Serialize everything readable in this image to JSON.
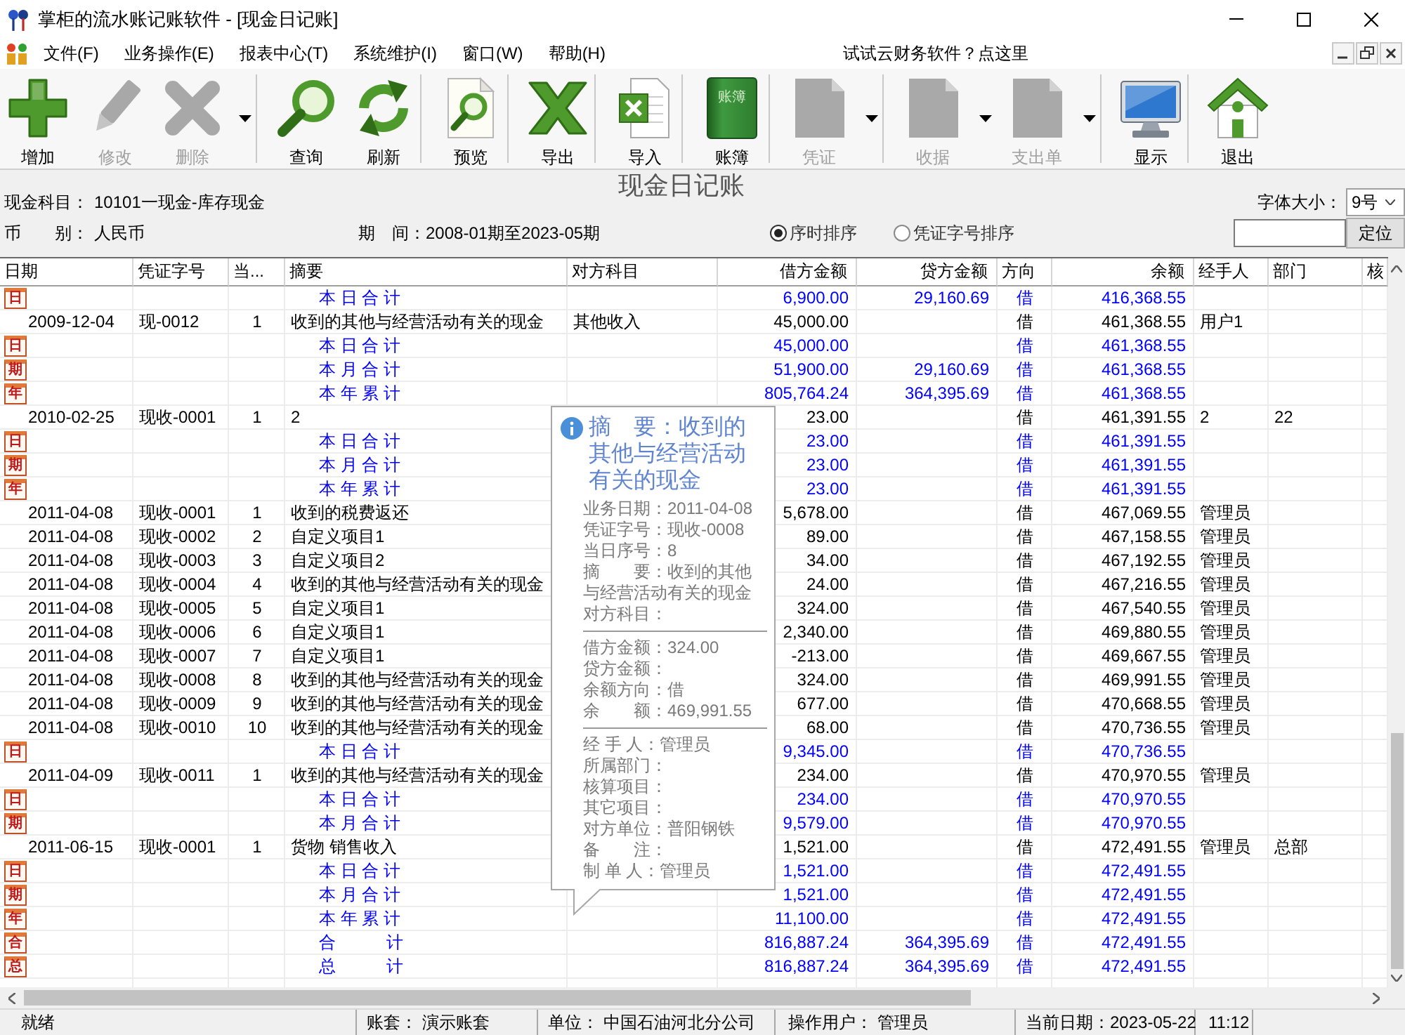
{
  "window": {
    "title": "掌柜的流水账记账软件 - [现金日记账]"
  },
  "menu": {
    "items": [
      "文件(F)",
      "业务操作(E)",
      "报表中心(T)",
      "系统维护(I)",
      "窗口(W)",
      "帮助(H)"
    ],
    "promo_link": "试试云财务软件？点这里"
  },
  "toolbar_groups": [
    {
      "buttons": [
        {
          "label": "增加",
          "disabled": false,
          "dropdown": false
        },
        {
          "label": "修改",
          "disabled": true,
          "dropdown": false
        },
        {
          "label": "删除",
          "disabled": true,
          "dropdown": true
        }
      ]
    },
    {
      "buttons": [
        {
          "label": "查询",
          "disabled": false,
          "dropdown": false
        },
        {
          "label": "刷新",
          "disabled": false,
          "dropdown": false
        }
      ]
    },
    {
      "buttons": [
        {
          "label": "预览",
          "disabled": false,
          "dropdown": false
        }
      ]
    },
    {
      "buttons": [
        {
          "label": "导出",
          "disabled": false,
          "dropdown": false
        }
      ]
    },
    {
      "buttons": [
        {
          "label": "导入",
          "disabled": false,
          "dropdown": false
        }
      ]
    },
    {
      "buttons": [
        {
          "label": "账簿",
          "cover_text": "账簿",
          "disabled": false,
          "dropdown": false
        }
      ]
    },
    {
      "buttons": [
        {
          "label": "凭证",
          "disabled": true,
          "dropdown": true
        }
      ]
    },
    {
      "buttons": [
        {
          "label": "收据",
          "disabled": true,
          "dropdown": true
        },
        {
          "label": "支出单",
          "disabled": true,
          "dropdown": true
        }
      ]
    },
    {
      "buttons": [
        {
          "label": "显示",
          "disabled": false,
          "dropdown": false
        }
      ]
    },
    {
      "buttons": [
        {
          "label": "退出",
          "disabled": false,
          "dropdown": false
        }
      ]
    }
  ],
  "header": {
    "title": "现金日记账",
    "account_label": "现金科目：",
    "account": "10101一现金-库存现金",
    "currency_label": "币　　别：",
    "currency": "人民币",
    "period_label": "期　间：",
    "period": "2008-01期至2023-05期",
    "font_size_label": "字体大小：",
    "font_size": "9号",
    "sort_options": [
      {
        "label": "序时排序",
        "selected": true
      },
      {
        "label": "凭证字号排序",
        "selected": false
      }
    ],
    "locate_button": "定位"
  },
  "table": {
    "columns": [
      "日期",
      "凭证字号",
      "当...",
      "摘要",
      "对方科目",
      "借方金额",
      "贷方金额",
      "方向",
      "余额",
      "经手人",
      "部门",
      "核"
    ],
    "rows": [
      {
        "kind": "subtotal",
        "tag": "日",
        "summary": "本 日 合 计",
        "debit": "6,900.00",
        "credit": "29,160.69",
        "direction": "借",
        "balance": "416,368.55"
      },
      {
        "kind": "entry",
        "date": "2009-12-04",
        "voucher": "现-0012",
        "seq": "1",
        "summary": "收到的其他与经营活动有关的现金",
        "counter_account": "其他收入",
        "debit": "45,000.00",
        "direction": "借",
        "balance": "461,368.55",
        "handler": "用户1"
      },
      {
        "kind": "subtotal",
        "tag": "日",
        "summary": "本 日 合 计",
        "debit": "45,000.00",
        "direction": "借",
        "balance": "461,368.55"
      },
      {
        "kind": "subtotal",
        "tag": "期",
        "summary": "本 月 合 计",
        "debit": "51,900.00",
        "credit": "29,160.69",
        "direction": "借",
        "balance": "461,368.55"
      },
      {
        "kind": "subtotal",
        "tag": "年",
        "summary": "本 年 累 计",
        "debit": "805,764.24",
        "credit": "364,395.69",
        "direction": "借",
        "balance": "461,368.55"
      },
      {
        "kind": "entry",
        "date": "2010-02-25",
        "voucher": "现收-0001",
        "seq": "1",
        "summary": "2",
        "debit": "23.00",
        "direction": "借",
        "balance": "461,391.55",
        "handler": "2",
        "department": "22"
      },
      {
        "kind": "subtotal",
        "tag": "日",
        "summary": "本 日 合 计",
        "debit": "23.00",
        "direction": "借",
        "balance": "461,391.55"
      },
      {
        "kind": "subtotal",
        "tag": "期",
        "summary": "本 月 合 计",
        "debit": "23.00",
        "direction": "借",
        "balance": "461,391.55"
      },
      {
        "kind": "subtotal",
        "tag": "年",
        "summary": "本 年 累 计",
        "debit": "23.00",
        "direction": "借",
        "balance": "461,391.55"
      },
      {
        "kind": "entry",
        "date": "2011-04-08",
        "voucher": "现收-0001",
        "seq": "1",
        "summary": "收到的税费返还",
        "debit": "5,678.00",
        "direction": "借",
        "balance": "467,069.55",
        "handler": "管理员"
      },
      {
        "kind": "entry",
        "date": "2011-04-08",
        "voucher": "现收-0002",
        "seq": "2",
        "summary": "自定义项目1",
        "debit": "89.00",
        "direction": "借",
        "balance": "467,158.55",
        "handler": "管理员"
      },
      {
        "kind": "entry",
        "date": "2011-04-08",
        "voucher": "现收-0003",
        "seq": "3",
        "summary": "自定义项目2",
        "debit": "34.00",
        "direction": "借",
        "balance": "467,192.55",
        "handler": "管理员"
      },
      {
        "kind": "entry",
        "date": "2011-04-08",
        "voucher": "现收-0004",
        "seq": "4",
        "summary": "收到的其他与经营活动有关的现金",
        "debit": "24.00",
        "direction": "借",
        "balance": "467,216.55",
        "handler": "管理员"
      },
      {
        "kind": "entry",
        "date": "2011-04-08",
        "voucher": "现收-0005",
        "seq": "5",
        "summary": "自定义项目1",
        "debit": "324.00",
        "direction": "借",
        "balance": "467,540.55",
        "handler": "管理员"
      },
      {
        "kind": "entry",
        "date": "2011-04-08",
        "voucher": "现收-0006",
        "seq": "6",
        "summary": "自定义项目1",
        "debit": "2,340.00",
        "direction": "借",
        "balance": "469,880.55",
        "handler": "管理员"
      },
      {
        "kind": "entry",
        "date": "2011-04-08",
        "voucher": "现收-0007",
        "seq": "7",
        "summary": "自定义项目1",
        "debit": "-213.00",
        "direction": "借",
        "balance": "469,667.55",
        "handler": "管理员"
      },
      {
        "kind": "entry",
        "date": "2011-04-08",
        "voucher": "现收-0008",
        "seq": "8",
        "summary": "收到的其他与经营活动有关的现金",
        "debit": "324.00",
        "direction": "借",
        "balance": "469,991.55",
        "handler": "管理员"
      },
      {
        "kind": "entry",
        "date": "2011-04-08",
        "voucher": "现收-0009",
        "seq": "9",
        "summary": "收到的其他与经营活动有关的现金",
        "debit": "677.00",
        "direction": "借",
        "balance": "470,668.55",
        "handler": "管理员"
      },
      {
        "kind": "entry",
        "date": "2011-04-08",
        "voucher": "现收-0010",
        "seq": "10",
        "summary": "收到的其他与经营活动有关的现金",
        "debit": "68.00",
        "direction": "借",
        "balance": "470,736.55",
        "handler": "管理员"
      },
      {
        "kind": "subtotal",
        "tag": "日",
        "summary": "本 日 合 计",
        "debit": "9,345.00",
        "direction": "借",
        "balance": "470,736.55"
      },
      {
        "kind": "entry",
        "date": "2011-04-09",
        "voucher": "现收-0011",
        "seq": "1",
        "summary": "收到的其他与经营活动有关的现金",
        "debit": "234.00",
        "direction": "借",
        "balance": "470,970.55",
        "handler": "管理员"
      },
      {
        "kind": "subtotal",
        "tag": "日",
        "summary": "本 日 合 计",
        "debit": "234.00",
        "direction": "借",
        "balance": "470,970.55"
      },
      {
        "kind": "subtotal",
        "tag": "期",
        "summary": "本 月 合 计",
        "debit": "9,579.00",
        "direction": "借",
        "balance": "470,970.55"
      },
      {
        "kind": "entry",
        "date": "2011-06-15",
        "voucher": "现收-0001",
        "seq": "1",
        "summary": "货物 销售收入",
        "debit": "1,521.00",
        "direction": "借",
        "balance": "472,491.55",
        "handler": "管理员",
        "department": "总部"
      },
      {
        "kind": "subtotal",
        "tag": "日",
        "summary": "本 日 合 计",
        "debit": "1,521.00",
        "direction": "借",
        "balance": "472,491.55"
      },
      {
        "kind": "subtotal",
        "tag": "期",
        "summary": "本 月 合 计",
        "debit": "1,521.00",
        "direction": "借",
        "balance": "472,491.55"
      },
      {
        "kind": "subtotal",
        "tag": "年",
        "summary": "本 年 累 计",
        "debit": "11,100.00",
        "direction": "借",
        "balance": "472,491.55"
      },
      {
        "kind": "subtotal",
        "tag": "合",
        "summary": "合　　　计",
        "debit": "816,887.24",
        "credit": "364,395.69",
        "direction": "借",
        "balance": "472,491.55"
      },
      {
        "kind": "subtotal",
        "tag": "总",
        "summary": "总　　　计",
        "debit": "816,887.24",
        "credit": "364,395.69",
        "direction": "借",
        "balance": "472,491.55"
      }
    ]
  },
  "tooltip": {
    "title": "摘　要：收到的其他与经营活动有关的现金",
    "sections": [
      [
        "业务日期：2011-04-08",
        "凭证字号：现收-0008",
        "当日序号：8",
        "摘　　要：收到的其他与经营活动有关的现金",
        "对方科目："
      ],
      [
        "借方金额：324.00",
        "贷方金额：",
        "余额方向：借",
        "余　　额：469,991.55"
      ],
      [
        "经 手 人：管理员",
        "所属部门：",
        "核算项目：",
        "其它项目：",
        "对方单位：普阳钢铁",
        "备　　注：",
        "制 单 人：管理员"
      ]
    ]
  },
  "status_bar": [
    "就绪",
    "账套： 演示账套",
    "单位： 中国石油河北分公司",
    "操作用户： 管理员",
    "当前日期：2023-05-22",
    "11:12"
  ]
}
